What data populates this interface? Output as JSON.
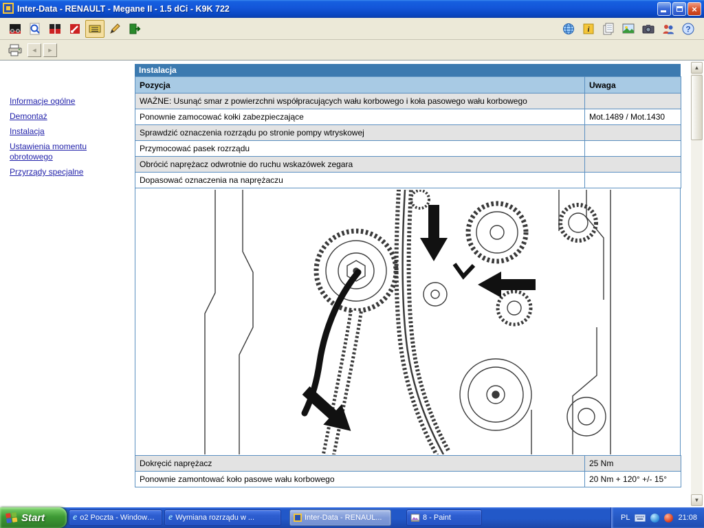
{
  "colors": {
    "titlebar_blue": "#1355D8",
    "section_header_blue": "#3C7AB0",
    "column_header_blue": "#A8CAE4",
    "table_border_blue": "#5A8FC0",
    "row_gray": "#E3E3E3",
    "toolbar_bg": "#ECE9D8",
    "taskbar_blue": "#2258C8",
    "start_green": "#3E9A35"
  },
  "window": {
    "title": "Inter-Data - RENAULT - Megane II - 1.5 dCi - K9K 722"
  },
  "icons": {
    "close": "×",
    "back_arrow": "◄",
    "forward_arrow": "►",
    "scroll_up": "▲",
    "scroll_down": "▼",
    "ie_logo": "e"
  },
  "sidebar": {
    "items": [
      {
        "label": "Informacje ogólne"
      },
      {
        "label": "Demontaż"
      },
      {
        "label": "Instalacja"
      },
      {
        "label": "Ustawienia momentu obrotowego"
      },
      {
        "label": "Przyrządy specjalne"
      }
    ]
  },
  "content": {
    "section_title": "Instalacja",
    "table": {
      "headers": [
        "Pozycja",
        "Uwaga"
      ],
      "rows": [
        {
          "pozycja": "WAŻNE: Usunąć smar z powierzchni współpracujących wału korbowego i koła pasowego wału korbowego",
          "uwaga": ""
        },
        {
          "pozycja": "Ponownie zamocować kołki zabezpieczające",
          "uwaga": "Mot.1489 / Mot.1430"
        },
        {
          "pozycja": "Sprawdzić oznaczenia rozrządu po stronie pompy wtryskowej",
          "uwaga": ""
        },
        {
          "pozycja": "Przymocować pasek rozrządu",
          "uwaga": ""
        },
        {
          "pozycja": "Obrócić naprężacz odwrotnie do ruchu wskazówek zegara",
          "uwaga": ""
        },
        {
          "pozycja": "Dopasować oznaczenia na naprężaczu",
          "uwaga": ""
        }
      ],
      "bottom_rows": [
        {
          "pozycja": "Dokręcić naprężacz",
          "uwaga": "25 Nm"
        },
        {
          "pozycja": "Ponownie zamontować koło pasowe wału korbowego",
          "uwaga": "20 Nm + 120° +/- 15°"
        }
      ]
    }
  },
  "taskbar": {
    "start_label": "Start",
    "items": [
      {
        "label": "o2 Poczta - Windows ..."
      },
      {
        "label": "Wymiana rozrządu w ..."
      },
      {
        "label": "Inter-Data - RENAUL..."
      },
      {
        "label": "8 - Paint"
      }
    ],
    "tray": {
      "lang": "PL",
      "time": "21:08"
    }
  }
}
